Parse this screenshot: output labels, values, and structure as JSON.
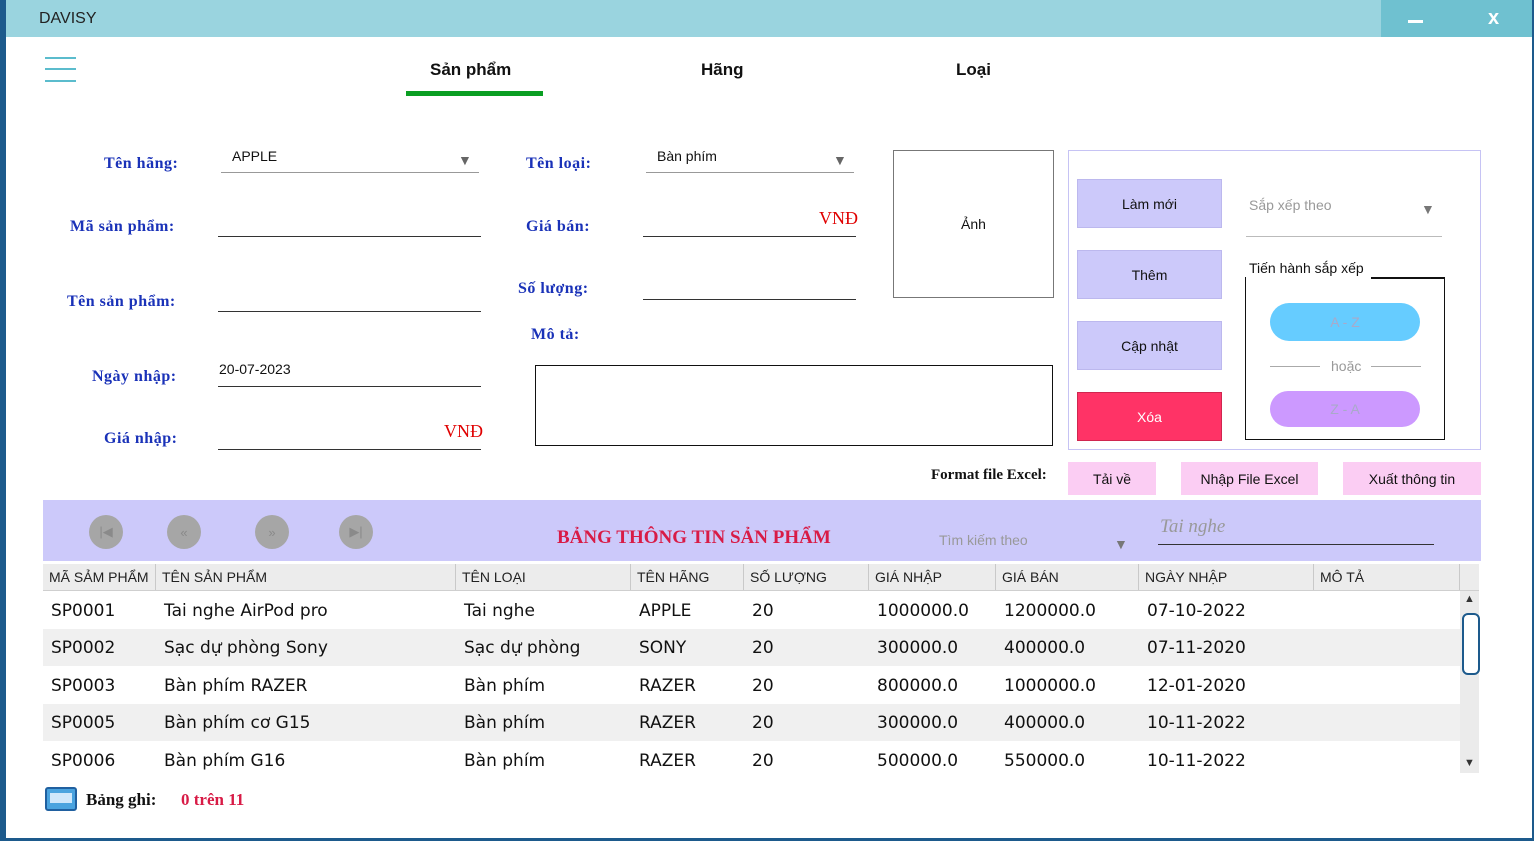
{
  "app": {
    "title": "DAVISY",
    "minimize": "—",
    "close": "x"
  },
  "tabs": [
    {
      "label": "Sản phẩm"
    },
    {
      "label": "Hãng"
    },
    {
      "label": "Loại"
    }
  ],
  "form": {
    "ten_hang": {
      "label": "Tên hãng:",
      "value": "APPLE"
    },
    "ma_sp": {
      "label": "Mã sản phẩm:",
      "value": ""
    },
    "ten_sp": {
      "label": "Tên sản phẩm:",
      "value": ""
    },
    "ngay_nhap": {
      "label": "Ngày nhập:",
      "value": "20-07-2023"
    },
    "gia_nhap": {
      "label": "Giá nhập:",
      "value": "",
      "unit": "VNĐ"
    },
    "ten_loai": {
      "label": "Tên loại:",
      "value": "Bàn phím"
    },
    "gia_ban": {
      "label": "Giá bán:",
      "value": "",
      "unit": "VNĐ"
    },
    "so_luong": {
      "label": "Số lượng:",
      "value": ""
    },
    "mo_ta": {
      "label": "Mô tả:",
      "value": ""
    },
    "image_label": "Ảnh"
  },
  "actions": {
    "refresh": "Làm mới",
    "add": "Thêm",
    "update": "Cập nhật",
    "delete": "Xóa",
    "delete_color": "#ff3366"
  },
  "sort": {
    "placeholder": "Sắp xếp theo",
    "proceed": "Tiến hành sắp xếp",
    "az": "A - Z",
    "or": "hoặc",
    "za": "Z - A",
    "az_color": "#66ccff",
    "za_color": "#cc99ff"
  },
  "excel": {
    "label": "Format file Excel:",
    "download": "Tải về",
    "import": "Nhập File Excel",
    "export": "Xuất thông tin"
  },
  "table_bar": {
    "title": "BẢNG THÔNG TIN SẢN PHẨM",
    "search_by": "Tìm kiếm theo",
    "search_value": "Tai nghe"
  },
  "table": {
    "columns": [
      "MÃ SẢM PHẨM",
      "TÊN SẢN PHẨM",
      "TÊN LOẠI",
      "TÊN HÃNG",
      "SỐ LƯỢNG",
      "GIÁ NHẬP",
      "GIÁ BÁN",
      "NGÀY NHẬP",
      "MÔ TẢ"
    ],
    "rows": [
      [
        "SP0001",
        "Tai nghe AirPod pro",
        "Tai nghe",
        "APPLE",
        "20",
        "1000000.0",
        "1200000.0",
        "07-10-2022",
        ""
      ],
      [
        "SP0002",
        "Sạc dự phòng Sony",
        "Sạc dự phòng",
        "SONY",
        "20",
        "300000.0",
        "400000.0",
        "07-11-2020",
        ""
      ],
      [
        "SP0003",
        "Bàn phím RAZER",
        "Bàn phím",
        "RAZER",
        "20",
        "800000.0",
        "1000000.0",
        "12-01-2020",
        ""
      ],
      [
        "SP0005",
        "Bàn phím cơ G15",
        "Bàn phím",
        "RAZER",
        "20",
        "300000.0",
        "400000.0",
        "10-11-2022",
        ""
      ],
      [
        "SP0006",
        "Bàn phím G16",
        "Bàn phím",
        "RAZER",
        "20",
        "500000.0",
        "550000.0",
        "10-11-2022",
        ""
      ]
    ]
  },
  "footer": {
    "records_label": "Bảng ghi:",
    "records_value": "0 trên 11"
  }
}
